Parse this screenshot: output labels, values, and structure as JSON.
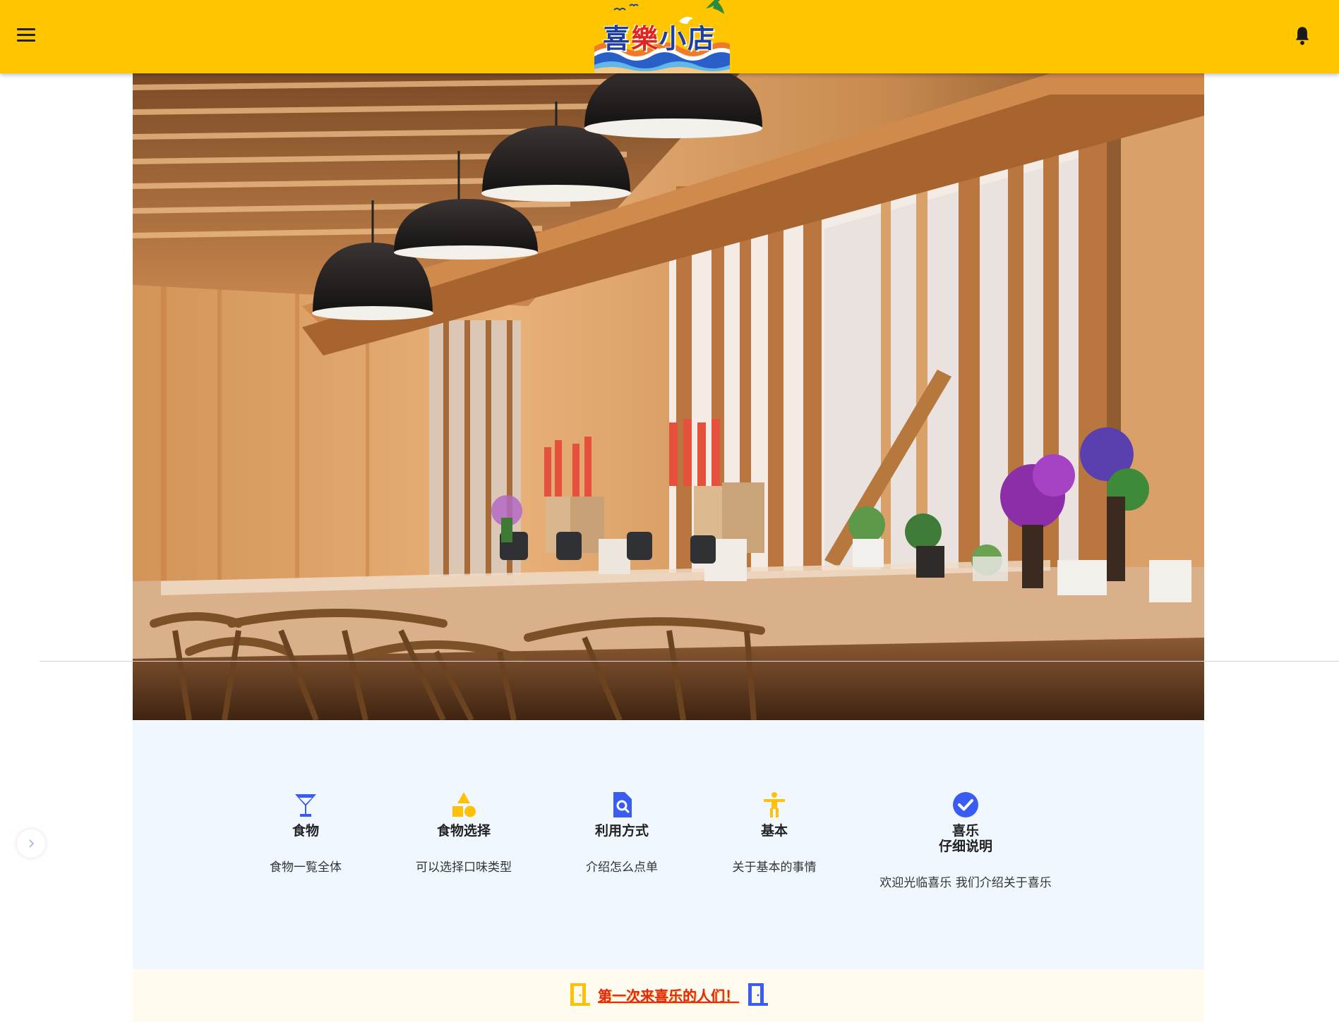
{
  "header": {
    "logo_text_a": "喜",
    "logo_text_b": "樂",
    "logo_text_c": "小店",
    "menu_icon": "hamburger-menu-icon",
    "bell_icon": "bell-icon"
  },
  "colors": {
    "header_bg": "#ffc600",
    "features_bg": "#f0f7ff",
    "welcome_bg": "#fffbee",
    "icon_blue": "#3b5cf0",
    "icon_yellow": "#ffc107",
    "welcome_text": "#e0281e"
  },
  "hero": {
    "alt": ""
  },
  "features": [
    {
      "icon": "cocktail-glass-icon",
      "title": "食物",
      "desc": "食物一覧全体"
    },
    {
      "icon": "shapes-icon",
      "title": "食物选择",
      "desc": "可以选择口味类型"
    },
    {
      "icon": "file-search-icon",
      "title": "利用方式",
      "desc": "介绍怎么点单"
    },
    {
      "icon": "accessibility-icon",
      "title": "基本",
      "desc": "关于基本的事情"
    },
    {
      "icon": "check-circle-icon",
      "title_line1": "喜乐",
      "title_line2": "仔细说明",
      "desc": "欢迎光临喜乐 我们介绍关于喜乐"
    }
  ],
  "carousel": {
    "next_icon": "chevron-right-icon"
  },
  "welcome": {
    "text": "第一次来喜乐的人们！",
    "left_icon": "door-icon",
    "right_icon": "door-icon"
  }
}
